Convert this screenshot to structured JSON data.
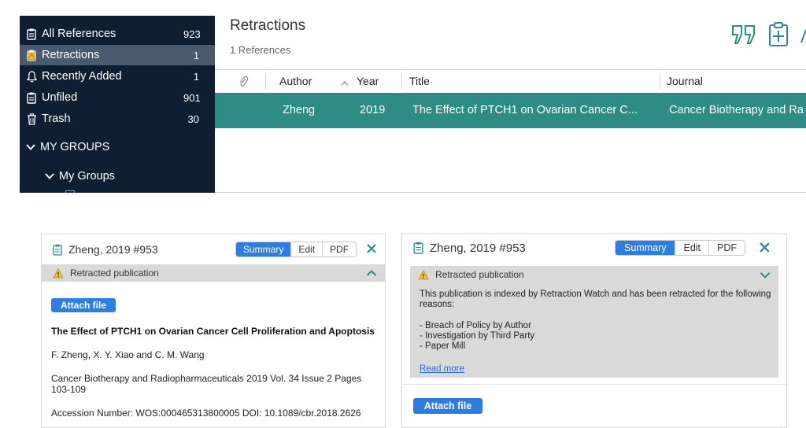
{
  "sidebar": {
    "items": [
      {
        "label": "All References",
        "count": "923",
        "icon": "document-icon"
      },
      {
        "label": "Retractions",
        "count": "1",
        "icon": "retraction-icon"
      },
      {
        "label": "Recently Added",
        "count": "1",
        "icon": "bell-icon"
      },
      {
        "label": "Unfiled",
        "count": "901",
        "icon": "document-icon"
      },
      {
        "label": "Trash",
        "count": "30",
        "icon": "trash-icon"
      }
    ],
    "my_groups_header": "MY GROUPS",
    "my_groups_sub": "My Groups"
  },
  "list": {
    "title": "Retractions",
    "subtitle": "1 References",
    "columns": {
      "attachment": "",
      "author": "Author",
      "year": "Year",
      "title": "Title",
      "journal": "Journal"
    },
    "rows": [
      {
        "author": "Zheng",
        "year": "2019",
        "title": "The Effect of PTCH1 on Ovarian Cancer C...",
        "journal": "Cancer Biotherapy and Ra"
      }
    ]
  },
  "panel_left": {
    "header": "Zheng, 2019 #953",
    "tabs": [
      "Summary",
      "Edit",
      "PDF"
    ],
    "warning": "Retracted publication",
    "attach_label": "Attach file",
    "ref_title": "The Effect of PTCH1 on Ovarian Cancer Cell Proliferation and Apoptosis",
    "authors": "F. Zheng, X. Y. Xiao and C. M. Wang",
    "journal_line1": "Cancer Biotherapy and Radiopharmaceuticals 2019 Vol. 34 Issue 2 Pages",
    "journal_line2": "103-109",
    "accession": "Accession Number: WOS:000465313800005 DOI: 10.1089/cbr.2018.2626"
  },
  "panel_right": {
    "header": "Zheng, 2019 #953",
    "tabs": [
      "Summary",
      "Edit",
      "PDF"
    ],
    "warning": "Retracted publication",
    "notice_line1": "This publication is indexed by Retraction Watch and has been retracted for the following",
    "notice_line2": "reasons:",
    "reasons": [
      "- Breach of Policy by Author",
      "- Investigation by Third Party",
      "- Paper Mill"
    ],
    "read_more": "Read more",
    "attach_label": "Attach file"
  },
  "colors": {
    "sidebar_bg": "#0f1e33",
    "selected_row": "#2e8b86",
    "accent": "#2f7de1",
    "close_x": "#2e8b86"
  }
}
